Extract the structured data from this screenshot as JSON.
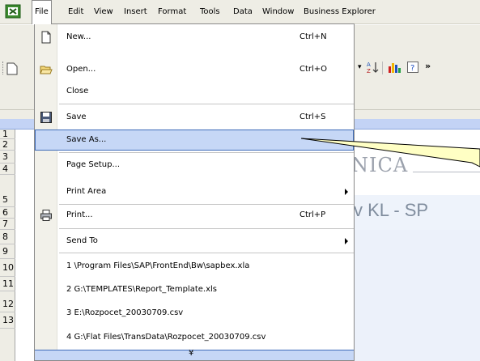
{
  "menubar": {
    "items": [
      "File",
      "Edit",
      "View",
      "Insert",
      "Format",
      "Tools",
      "Data",
      "Window",
      "Business Explorer"
    ]
  },
  "file_menu": {
    "items": [
      {
        "label": "New...",
        "shortcut": "Ctrl+N",
        "icon": "new-document-icon"
      },
      {
        "label": "Open...",
        "shortcut": "Ctrl+O",
        "icon": "open-folder-icon"
      },
      {
        "label": "Close",
        "shortcut": ""
      },
      {
        "label": "Save",
        "shortcut": "Ctrl+S",
        "icon": "floppy-disk-icon"
      },
      {
        "label": "Save As...",
        "shortcut": "",
        "highlighted": true
      },
      {
        "label": "Page Setup...",
        "shortcut": ""
      },
      {
        "label": "Print Area",
        "shortcut": "",
        "submenu": true
      },
      {
        "label": "Print...",
        "shortcut": "Ctrl+P",
        "icon": "printer-icon"
      },
      {
        "label": "Send To",
        "shortcut": "",
        "submenu": true
      },
      {
        "label": "1 \\Program Files\\SAP\\FrontEnd\\Bw\\sapbex.xla",
        "shortcut": ""
      },
      {
        "label": "2 G:\\TEMPLATES\\Report_Template.xls",
        "shortcut": ""
      },
      {
        "label": "3 E:\\Rozpocet_20030709.csv",
        "shortcut": ""
      },
      {
        "label": "4 G:\\Flat Files\\TransData\\Rozpocet_20030709.csv",
        "shortcut": ""
      }
    ],
    "expand_glyph": "¥"
  },
  "sheet": {
    "row_numbers": [
      "1",
      "2",
      "3",
      "4",
      "5",
      "6",
      "7",
      "8",
      "9",
      "10",
      "11",
      "12",
      "13"
    ],
    "fragments": {
      "title_1": "NICA",
      "title_2": "v KL - SP"
    }
  },
  "colors": {
    "highlight_fill": "#c6d7f6",
    "highlight_border": "#3f6cb9",
    "callout_fill": "#ffffc4",
    "chrome": "#eeede5"
  }
}
